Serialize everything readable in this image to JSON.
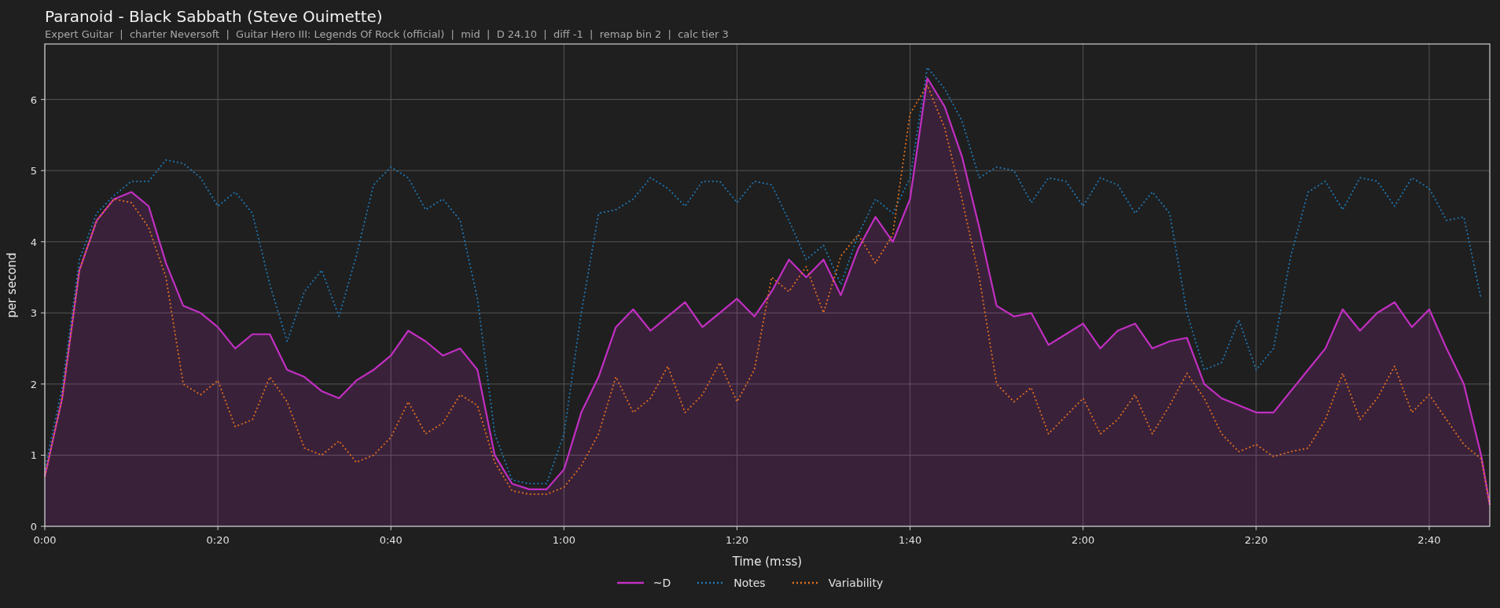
{
  "title": "Paranoid - Black Sabbath (Steve Ouimette)",
  "subtitle": "Expert Guitar  |  charter Neversoft  |  Guitar Hero III: Legends Of Rock (official)  |  mid  |  D 24.10  |  diff -1  |  remap bin 2  |  calc tier 3",
  "chart_data": {
    "type": "line",
    "xlabel": "Time (m:ss)",
    "ylabel": "per second",
    "x": [
      0,
      2,
      4,
      6,
      8,
      10,
      12,
      14,
      16,
      18,
      20,
      22,
      24,
      26,
      28,
      30,
      32,
      34,
      36,
      38,
      40,
      42,
      44,
      46,
      48,
      50,
      52,
      54,
      56,
      58,
      60,
      62,
      64,
      66,
      68,
      70,
      72,
      74,
      76,
      78,
      80,
      82,
      84,
      86,
      88,
      90,
      92,
      94,
      96,
      98,
      100,
      102,
      104,
      106,
      108,
      110,
      112,
      114,
      116,
      118,
      120,
      122,
      124,
      126,
      128,
      130,
      132,
      134,
      136,
      138,
      140,
      142,
      144,
      146,
      148,
      150,
      152,
      154,
      156,
      158,
      160,
      162,
      164,
      166,
      167
    ],
    "xlim": [
      0,
      167
    ],
    "ylim": [
      0,
      6.78
    ],
    "xticks": [
      {
        "value": 0,
        "label": "0:00"
      },
      {
        "value": 20,
        "label": "0:20"
      },
      {
        "value": 40,
        "label": "0:40"
      },
      {
        "value": 60,
        "label": "1:00"
      },
      {
        "value": 80,
        "label": "1:20"
      },
      {
        "value": 100,
        "label": "1:40"
      },
      {
        "value": 120,
        "label": "2:00"
      },
      {
        "value": 140,
        "label": "2:20"
      },
      {
        "value": 160,
        "label": "2:40"
      }
    ],
    "yticks": [
      0,
      1,
      2,
      3,
      4,
      5,
      6
    ],
    "grid": true,
    "legend": true,
    "series": [
      {
        "name": "~D",
        "color": "#c22fc2",
        "type": "area",
        "line_style": "solid",
        "values": [
          0.7,
          1.8,
          3.6,
          4.3,
          4.6,
          4.7,
          4.5,
          3.7,
          3.1,
          3.0,
          2.8,
          2.5,
          2.7,
          2.7,
          2.2,
          2.1,
          1.9,
          1.8,
          2.05,
          2.2,
          2.4,
          2.75,
          2.6,
          2.4,
          2.5,
          2.2,
          1.0,
          0.6,
          0.52,
          0.52,
          0.8,
          1.6,
          2.1,
          2.8,
          3.05,
          2.75,
          2.95,
          3.15,
          2.8,
          3.0,
          3.2,
          2.95,
          3.3,
          3.75,
          3.5,
          3.75,
          3.25,
          3.9,
          4.35,
          4.0,
          4.6,
          6.3,
          5.9,
          5.2,
          4.2,
          3.1,
          2.95,
          3.0,
          2.55,
          2.7,
          2.85,
          2.5,
          2.75,
          2.85,
          2.5,
          2.6,
          2.65,
          2.0,
          1.8,
          1.7,
          1.6,
          1.6,
          1.9,
          2.2,
          2.5,
          3.05,
          2.75,
          3.0,
          3.15,
          2.8,
          3.05,
          2.5,
          2.0,
          1.0,
          0.3
        ]
      },
      {
        "name": "Notes",
        "color": "#1f77b4",
        "type": "line",
        "line_style": "dotted",
        "values": [
          0.8,
          1.95,
          3.75,
          4.4,
          4.65,
          4.85,
          4.85,
          5.15,
          5.1,
          4.9,
          4.5,
          4.7,
          4.4,
          3.4,
          2.6,
          3.3,
          3.6,
          2.95,
          3.8,
          4.8,
          5.05,
          4.9,
          4.45,
          4.6,
          4.3,
          3.2,
          1.3,
          0.65,
          0.6,
          0.6,
          1.3,
          3.0,
          4.4,
          4.45,
          4.6,
          4.9,
          4.75,
          4.5,
          4.85,
          4.85,
          4.55,
          4.85,
          4.8,
          4.3,
          3.75,
          3.95,
          3.4,
          4.1,
          4.6,
          4.4,
          4.9,
          6.45,
          6.15,
          5.7,
          4.9,
          5.05,
          5.0,
          4.55,
          4.9,
          4.85,
          4.5,
          4.9,
          4.8,
          4.4,
          4.7,
          4.4,
          3.0,
          2.2,
          2.3,
          2.9,
          2.2,
          2.5,
          3.8,
          4.7,
          4.85,
          4.45,
          4.9,
          4.85,
          4.5,
          4.9,
          4.75,
          4.3,
          4.35,
          3.2,
          null
        ]
      },
      {
        "name": "Variability",
        "color": "#e0701e",
        "type": "line",
        "line_style": "dotted",
        "values": [
          0.7,
          1.8,
          3.6,
          4.3,
          4.6,
          4.55,
          4.2,
          3.5,
          2.0,
          1.85,
          2.05,
          1.4,
          1.5,
          2.1,
          1.75,
          1.1,
          1.0,
          1.2,
          0.9,
          1.0,
          1.25,
          1.75,
          1.3,
          1.45,
          1.85,
          1.7,
          0.9,
          0.5,
          0.45,
          0.45,
          0.55,
          0.85,
          1.3,
          2.1,
          1.6,
          1.8,
          2.25,
          1.6,
          1.85,
          2.3,
          1.75,
          2.2,
          3.5,
          3.3,
          3.65,
          3.0,
          3.8,
          4.1,
          3.7,
          4.1,
          5.8,
          6.2,
          5.6,
          4.6,
          3.5,
          2.0,
          1.75,
          1.95,
          1.3,
          1.55,
          1.8,
          1.3,
          1.5,
          1.85,
          1.3,
          1.7,
          2.15,
          1.8,
          1.3,
          1.05,
          1.15,
          0.98,
          1.05,
          1.1,
          1.5,
          2.15,
          1.5,
          1.8,
          2.25,
          1.6,
          1.85,
          1.5,
          1.15,
          0.95,
          0.3
        ]
      }
    ]
  }
}
